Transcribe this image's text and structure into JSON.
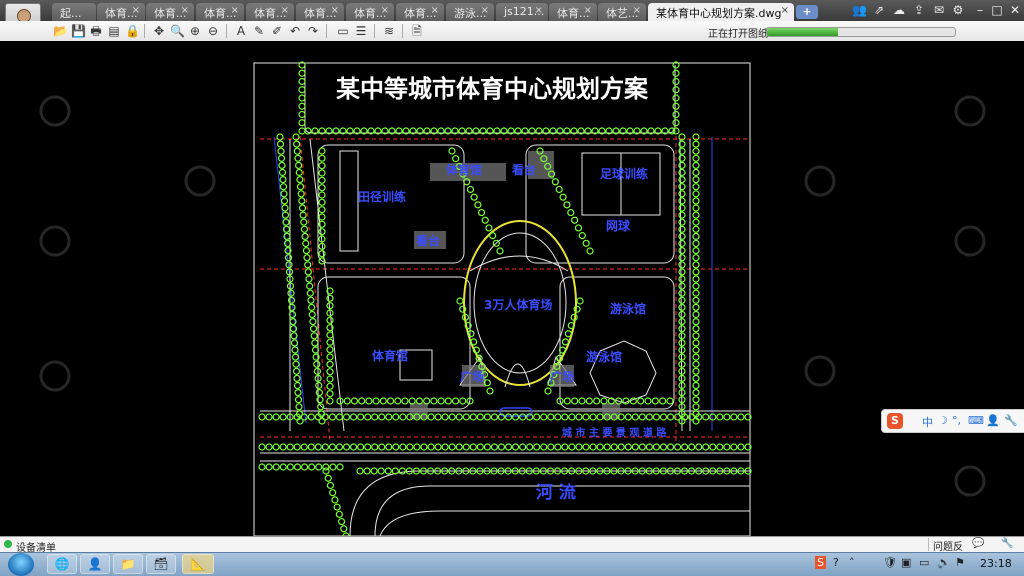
{
  "tabs": [
    {
      "label": "起..."
    },
    {
      "label": "体育..."
    },
    {
      "label": "体育..."
    },
    {
      "label": "体育..."
    },
    {
      "label": "体育..."
    },
    {
      "label": "体育..."
    },
    {
      "label": "体育..."
    },
    {
      "label": "体育..."
    },
    {
      "label": "游泳..."
    },
    {
      "label": "js121..."
    },
    {
      "label": "体育..."
    },
    {
      "label": "体艺..."
    },
    {
      "label": "某体育中心规划方案.dwg",
      "active": true
    }
  ],
  "new_tab_label": "+",
  "toolbar": {
    "status_text": "正在打开图纸",
    "progress": 0.38
  },
  "drawing": {
    "title": "某中等城市体育中心规划方案",
    "labels": {
      "athletics": "田径训练",
      "gym_top": "体育馆",
      "small_top": "看台",
      "football": "足球训练",
      "tennis": "网球",
      "stand": "看台",
      "stadium": "3万人体育场",
      "swim_top": "游泳馆",
      "gym": "体育馆",
      "swim": "游泳馆",
      "plaza_left": "广场",
      "plaza_right": "广场",
      "road": "城 市 主 要 景 观 道 路",
      "river": "河  流"
    }
  },
  "ime": {
    "mode": "中",
    "moon": "☽",
    "dot": "°,"
  },
  "status_bar": {
    "device_label": "设备清单",
    "feedback": "问题反馈"
  },
  "taskbar": {
    "clock": "23:18"
  },
  "colors": {
    "accent": "#2f9b25",
    "cad_green": "#7cff3a",
    "cad_blue": "#3344ff",
    "cad_red": "#ff2222",
    "cad_yellow": "#ffe033"
  }
}
